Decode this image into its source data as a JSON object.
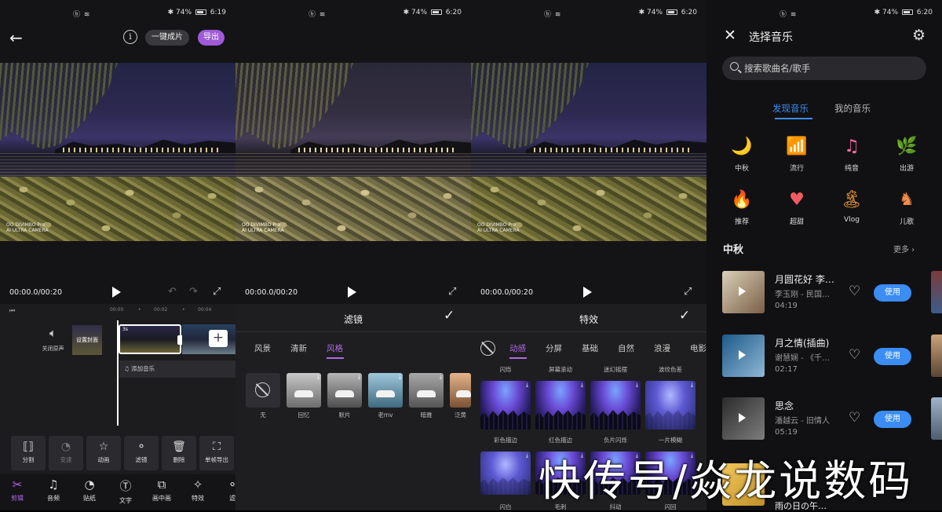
{
  "status": {
    "panel1": {
      "left": "ⓑ ≋",
      "battery": "74%",
      "time": "6:19"
    },
    "panel2": {
      "left": "ⓑ ≋",
      "battery": "74%",
      "time": "6:20"
    },
    "panel3": {
      "left": "ⓑ ≋",
      "battery": "74%",
      "time": "6:20"
    },
    "panel4": {
      "left": "ⓑ ≋",
      "battery": "74%",
      "time": "6:20"
    }
  },
  "editor": {
    "one_click_label": "一键成片",
    "export_label": "导出",
    "watermark_line1": "OO DIVIMBO Pro",
    "watermark_line2": "AI ULTRA CAMERA",
    "timecode": "00:00.0/00:20",
    "ruler": [
      "00:00",
      "00:02",
      "00:04"
    ],
    "mute_label": "关闭原声",
    "cover_label": "设置封面",
    "clip_duration": "3s",
    "add_music_label": "添加音乐",
    "tools": [
      {
        "icon": "split-icon",
        "glyph": "⟦⟧",
        "label": "分割",
        "enabled": true
      },
      {
        "icon": "speed-icon",
        "glyph": "◔",
        "label": "变速",
        "enabled": false
      },
      {
        "icon": "animation-icon",
        "glyph": "☆",
        "label": "动画",
        "enabled": true
      },
      {
        "icon": "filter-icon",
        "glyph": "⚬",
        "label": "滤镜",
        "enabled": true
      },
      {
        "icon": "delete-icon",
        "glyph": "🗑",
        "label": "删除",
        "enabled": true
      },
      {
        "icon": "frame-export-icon",
        "glyph": "⛶",
        "label": "单帧导出",
        "enabled": true
      }
    ],
    "nav": [
      {
        "icon": "scissors-icon",
        "glyph": "✂",
        "label": "剪辑",
        "active": true
      },
      {
        "icon": "music-note-icon",
        "glyph": "♫",
        "label": "音频",
        "active": false
      },
      {
        "icon": "sticker-icon",
        "glyph": "◔",
        "label": "贴纸",
        "active": false
      },
      {
        "icon": "text-icon",
        "glyph": "Ⓣ",
        "label": "文字",
        "active": false
      },
      {
        "icon": "pip-icon",
        "glyph": "⧉",
        "label": "画中画",
        "active": false
      },
      {
        "icon": "effects-icon",
        "glyph": "✧",
        "label": "特效",
        "active": false
      },
      {
        "icon": "filter-nav-icon",
        "glyph": "⚬",
        "label": "滤",
        "active": false
      }
    ]
  },
  "filters": {
    "timecode": "00:00.0/00:20",
    "title": "滤镜",
    "tabs": [
      {
        "label": "风景",
        "active": false
      },
      {
        "label": "清新",
        "active": false
      },
      {
        "label": "风格",
        "active": true
      }
    ],
    "none_label": "无",
    "items": [
      {
        "label": "回忆",
        "bg": "#9a9a9a"
      },
      {
        "label": "默片",
        "bg": "#7d7d7d"
      },
      {
        "label": "老mv",
        "bg": "#5f8fa8"
      },
      {
        "label": "暗雅",
        "bg": "#8c8c8c"
      },
      {
        "label": "泛黄",
        "bg": "#b88c63"
      }
    ]
  },
  "effects": {
    "timecode": "00:00.0/00:20",
    "title": "特效",
    "tabs": [
      {
        "label": "动感",
        "active": true
      },
      {
        "label": "分屏",
        "active": false
      },
      {
        "label": "基础",
        "active": false
      },
      {
        "label": "自然",
        "active": false
      },
      {
        "label": "浪漫",
        "active": false
      },
      {
        "label": "电影",
        "active": false
      }
    ],
    "top_labels": [
      "闪烁",
      "屏幕滚动",
      "迷幻摇摆",
      "波纹色差"
    ],
    "row1": [
      "彩色描边",
      "红色描边",
      "负片闪烁",
      "一片模糊"
    ],
    "row2": [
      "闪白",
      "毛刺",
      "抖动",
      "闪回"
    ]
  },
  "music": {
    "title": "选择音乐",
    "search_placeholder": "搜索歌曲名/歌手",
    "tabs": [
      {
        "label": "发现音乐",
        "active": true
      },
      {
        "label": "我的音乐",
        "active": false
      }
    ],
    "categories": [
      {
        "icon": "moon-icon",
        "glyph": "🌙",
        "label": "中秋"
      },
      {
        "icon": "chart-bars-icon",
        "glyph": "📶",
        "label": "流行"
      },
      {
        "icon": "note-icon",
        "glyph": "♫",
        "label": "纯音"
      },
      {
        "icon": "leaf-icon",
        "glyph": "🌿",
        "label": "出游"
      },
      {
        "icon": "flame-icon",
        "glyph": "🔥",
        "label": "推荐"
      },
      {
        "icon": "heart-icon",
        "glyph": "♥",
        "label": "超甜"
      },
      {
        "icon": "beach-icon",
        "glyph": "🏝",
        "label": "Vlog"
      },
      {
        "icon": "rocking-horse-icon",
        "glyph": "♞",
        "label": "儿歌"
      }
    ],
    "section": "中秋",
    "more": "更多 ›",
    "use_label": "使用",
    "songs": [
      {
        "name": "月圆花好 李…",
        "artist": "李玉刚 - 民国…",
        "duration": "04:19"
      },
      {
        "name": "月之情(插曲)",
        "artist": "谢慧娴 - 《千…",
        "duration": "02:17"
      },
      {
        "name": "思念",
        "artist": "潘越云 - 旧情人",
        "duration": "05:19"
      },
      {
        "name": "雨の日の午…",
        "artist": "",
        "duration": ""
      }
    ]
  },
  "overlay": "快传号/焱龙说数码",
  "colors": {
    "accent_purple": "#b069e8",
    "accent_blue": "#3b8cf3"
  }
}
